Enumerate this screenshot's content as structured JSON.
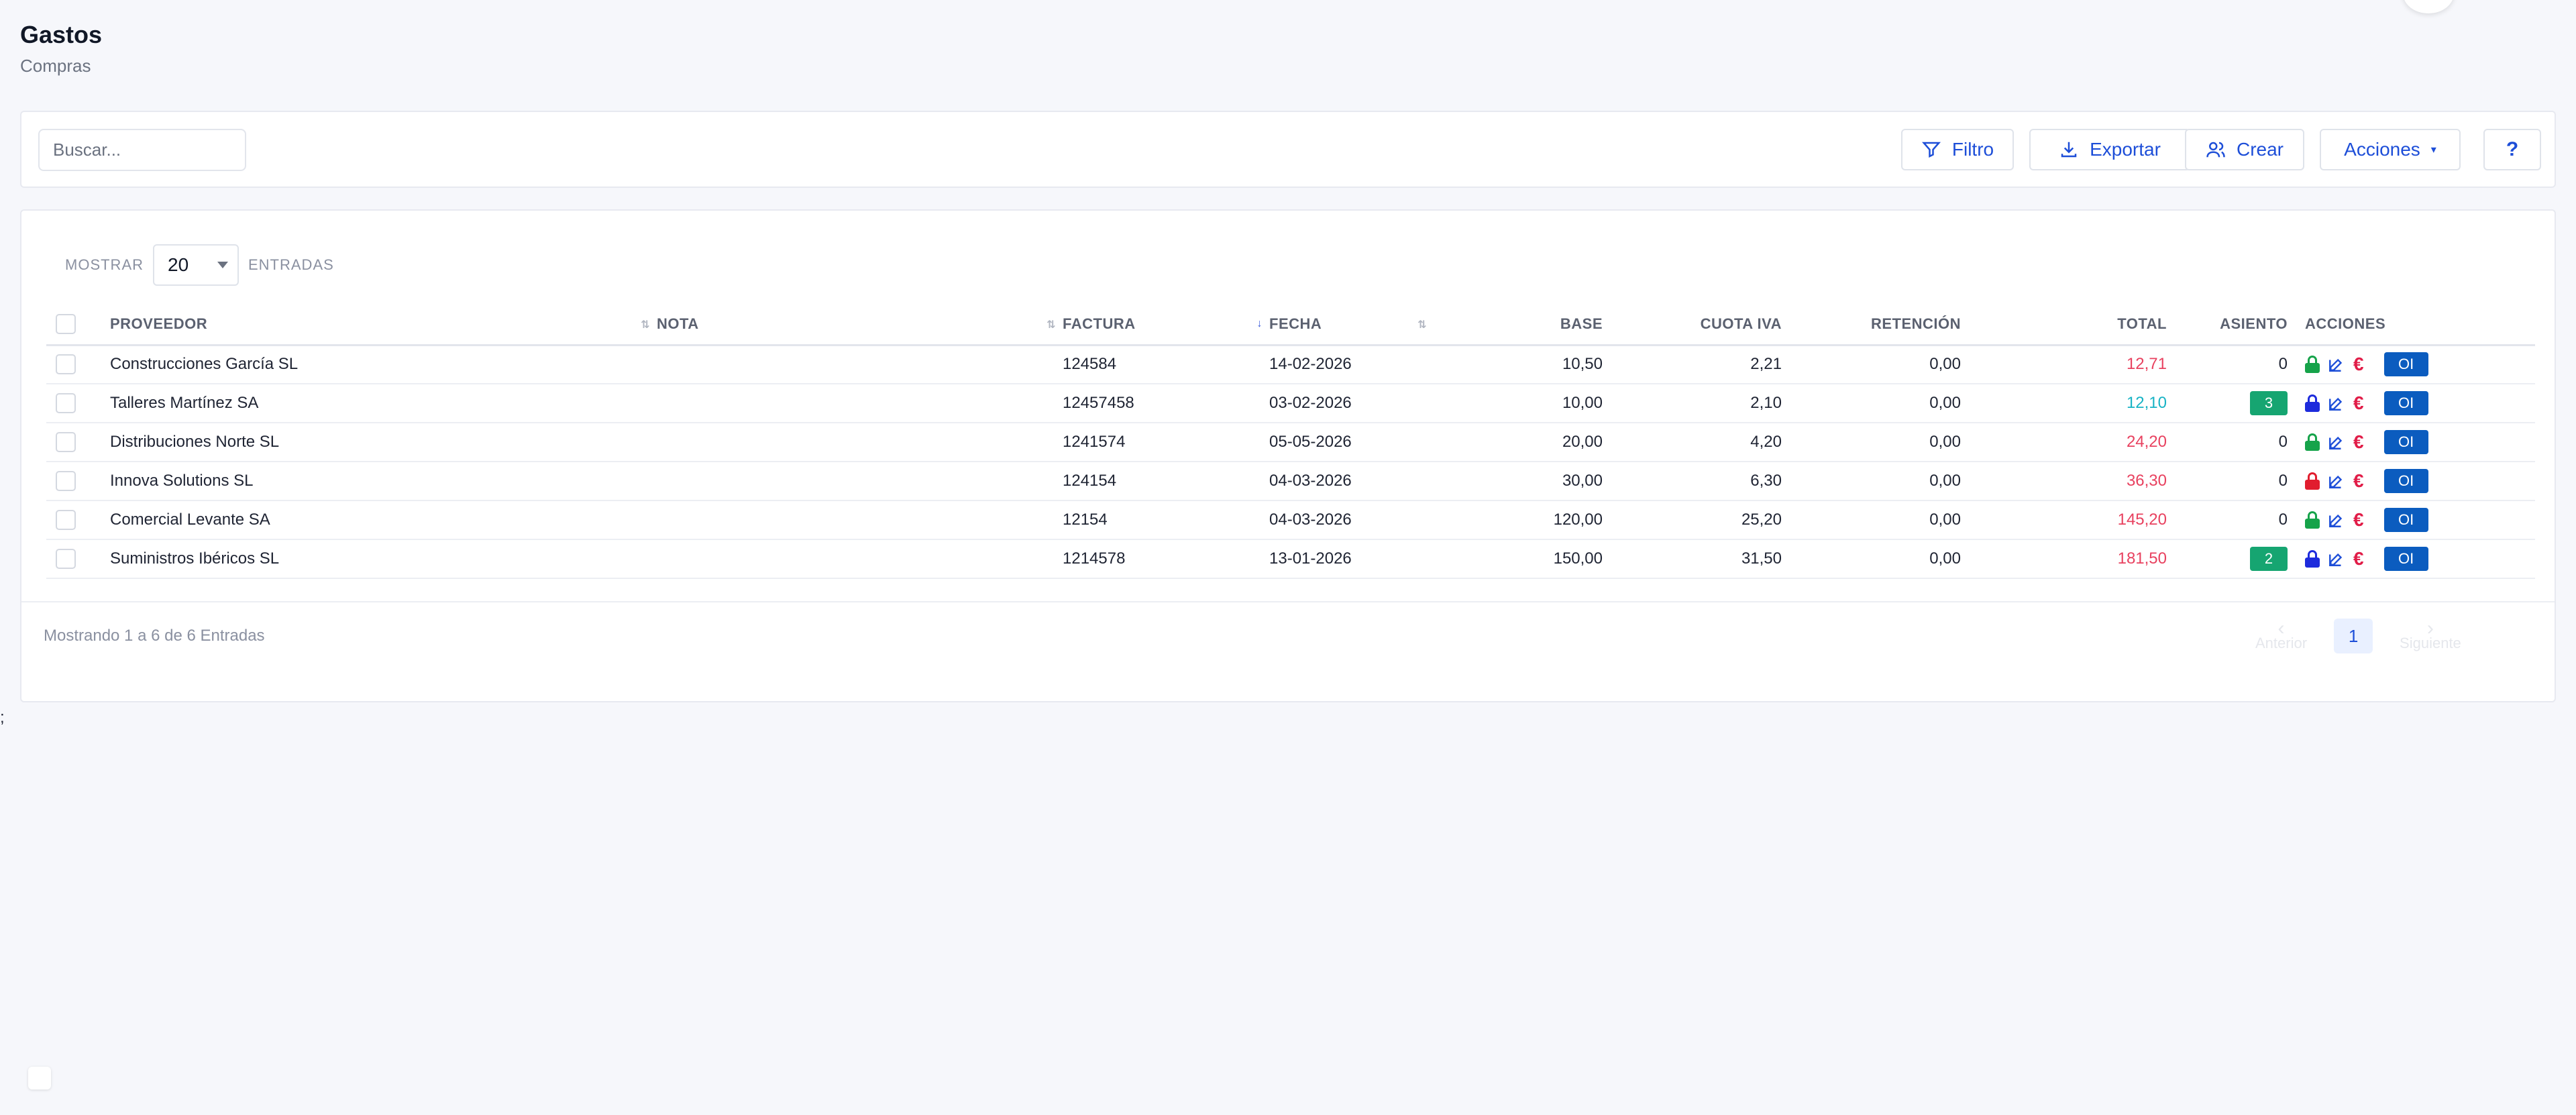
{
  "page": {
    "title": "Gastos",
    "subtitle": "Compras"
  },
  "toolbar": {
    "search_placeholder": "Buscar...",
    "filter_label": "Filtro",
    "export_label": "Exportar",
    "create_label": "Crear",
    "actions_label": "Acciones",
    "help_label": "?"
  },
  "table": {
    "show_label": "MOSTRAR",
    "page_size": "20",
    "entries_label": "ENTRADAS",
    "columns": [
      "PROVEEDOR",
      "NOTA",
      "FACTURA",
      "FECHA",
      "BASE",
      "CUOTA IVA",
      "RETENCIÓN",
      "TOTAL",
      "ASIENTO",
      "ACCIONES"
    ],
    "rows": [
      {
        "proveedor": "Construcciones García SL",
        "nota": "",
        "factura": "124584",
        "fecha": "14-02-2026",
        "base": "10,50",
        "cuota_iva": "2,21",
        "retencion": "0,00",
        "total": "12,71",
        "total_color": "#e8415f",
        "asiento": "0",
        "asiento_badge": false,
        "lock_color": "#16a34a",
        "oi_label": "OI"
      },
      {
        "proveedor": "Talleres Martínez SA",
        "nota": "",
        "factura": "12457458",
        "fecha": "03-02-2026",
        "base": "10,00",
        "cuota_iva": "2,10",
        "retencion": "0,00",
        "total": "12,10",
        "total_color": "#17b3c5",
        "asiento": "3",
        "asiento_badge": true,
        "lock_color": "#1d2bdc",
        "oi_label": "OI"
      },
      {
        "proveedor": "Distribuciones Norte SL",
        "nota": "",
        "factura": "1241574",
        "fecha": "05-05-2026",
        "base": "20,00",
        "cuota_iva": "4,20",
        "retencion": "0,00",
        "total": "24,20",
        "total_color": "#e8415f",
        "asiento": "0",
        "asiento_badge": false,
        "lock_color": "#16a34a",
        "oi_label": "OI"
      },
      {
        "proveedor": "Innova Solutions SL",
        "nota": "",
        "factura": "124154",
        "fecha": "04-03-2026",
        "base": "30,00",
        "cuota_iva": "6,30",
        "retencion": "0,00",
        "total": "36,30",
        "total_color": "#e8415f",
        "asiento": "0",
        "asiento_badge": false,
        "lock_color": "#e11d2e",
        "oi_label": "OI"
      },
      {
        "proveedor": "Comercial Levante SA",
        "nota": "",
        "factura": "12154",
        "fecha": "04-03-2026",
        "base": "120,00",
        "cuota_iva": "25,20",
        "retencion": "0,00",
        "total": "145,20",
        "total_color": "#e8415f",
        "asiento": "0",
        "asiento_badge": false,
        "lock_color": "#16a34a",
        "oi_label": "OI"
      },
      {
        "proveedor": "Suministros Ibéricos SL",
        "nota": "",
        "factura": "1214578",
        "fecha": "13-01-2026",
        "base": "150,00",
        "cuota_iva": "31,50",
        "retencion": "0,00",
        "total": "181,50",
        "total_color": "#e8415f",
        "asiento": "2",
        "asiento_badge": true,
        "lock_color": "#1d2bdc",
        "oi_label": "OI"
      }
    ]
  },
  "footer": {
    "showing_text": "Mostrando 1 a 6 de 6 Entradas",
    "prev_label": "Anterior",
    "next_label": "Siguiente",
    "current_page": "1"
  },
  "stray_text": ";",
  "colors": {
    "accent": "#1d4ed8",
    "badge_green": "#16a571",
    "oi_blue": "#0b5cbf",
    "euro_red": "#e11d48"
  }
}
